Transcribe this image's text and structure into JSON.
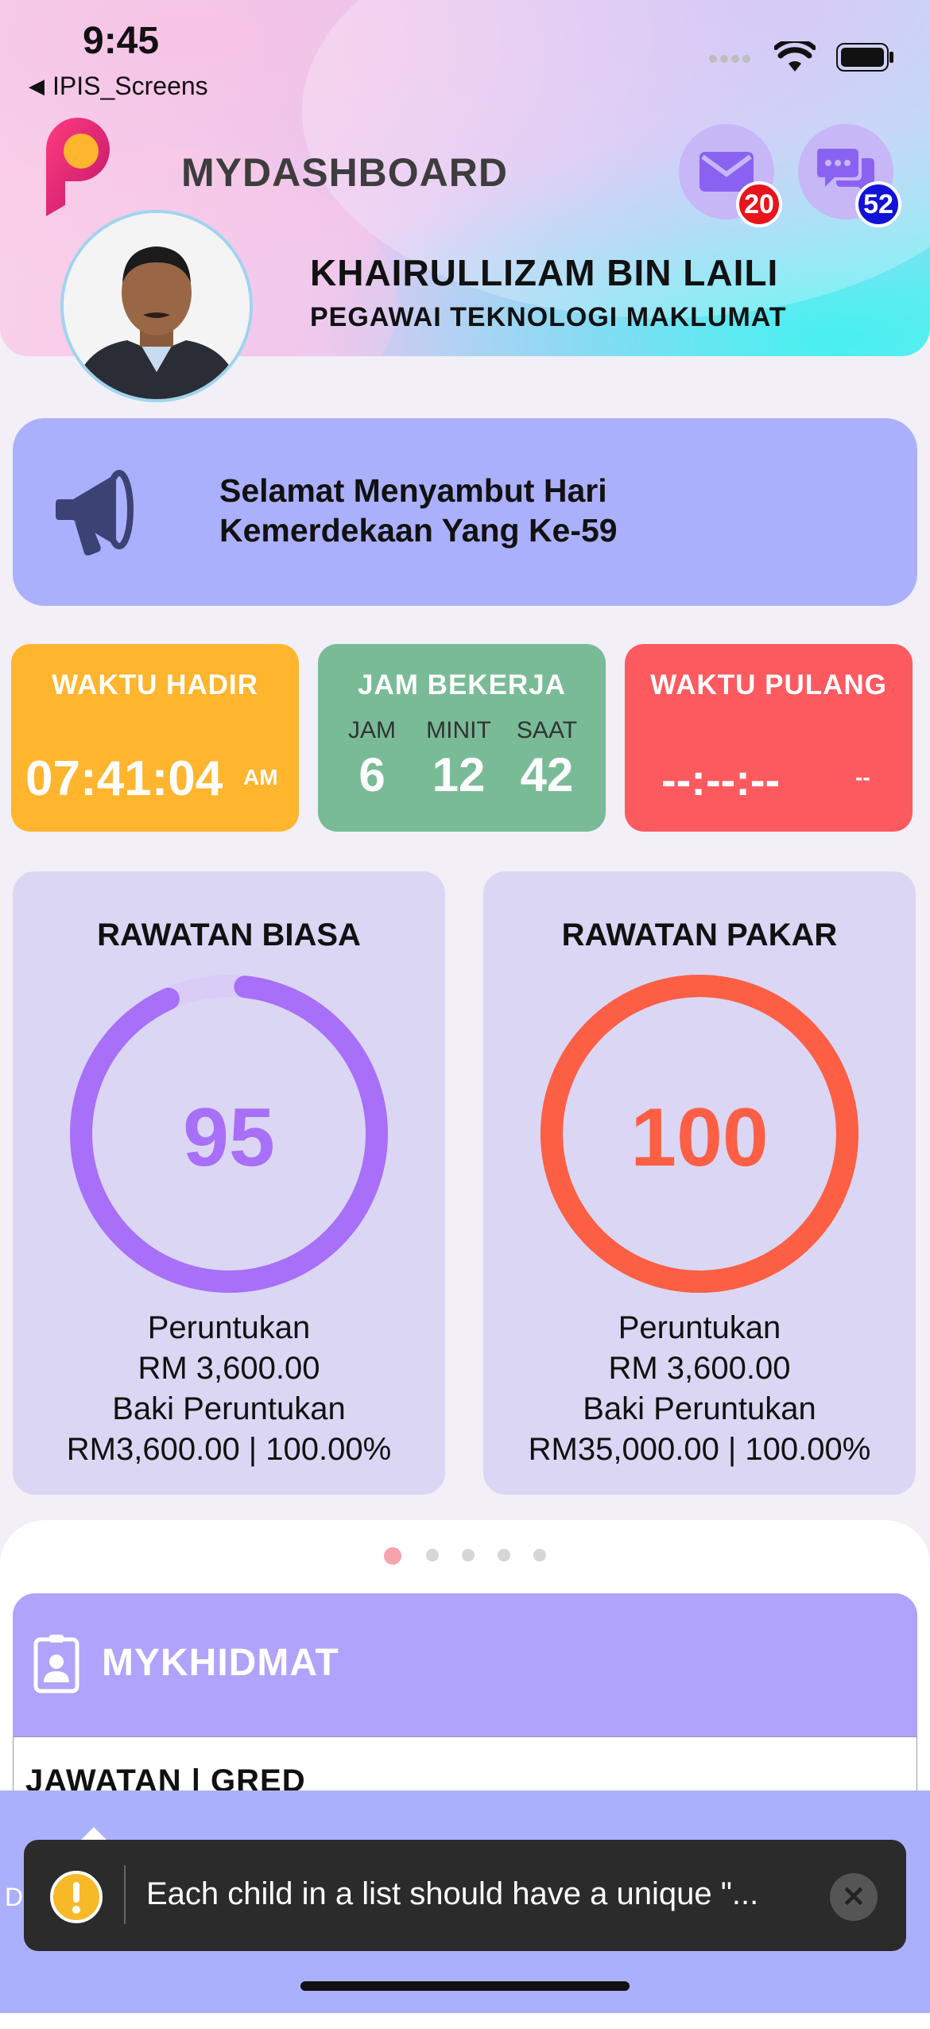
{
  "status_bar": {
    "time": "9:45",
    "back_app": "IPIS_Screens"
  },
  "header": {
    "title": "MYDASHBOARD",
    "mail_badge": "20",
    "chat_badge": "52",
    "user_name": "KHAIRULLIZAM BIN LAILI",
    "user_position": "PEGAWAI TEKNOLOGI MAKLUMAT"
  },
  "announcement": {
    "text": "Selamat Menyambut Hari Kemerdekaan Yang Ke-59"
  },
  "time_cards": {
    "arrival": {
      "label": "WAKTU HADIR",
      "time": "07:41:04",
      "period": "AM",
      "color": "#ffb52e"
    },
    "working": {
      "label": "JAM BEKERJA",
      "hours_label": "JAM",
      "minutes_label": "MINIT",
      "seconds_label": "SAAT",
      "hours": "6",
      "minutes": "12",
      "seconds": "42",
      "color": "#79bb97"
    },
    "departure": {
      "label": "WAKTU PULANG",
      "time": "--:--:--",
      "period": "--",
      "color": "#fd5a60"
    }
  },
  "treatments": [
    {
      "title": "RAWATAN BIASA",
      "value": "95",
      "progress_percent": 95,
      "allocation_label": "Peruntukan",
      "allocation": "RM 3,600.00",
      "balance_label": "Baki Peruntukan",
      "balance": "RM3,600.00 | 100.00%",
      "color": "#a86ff8",
      "track": "#d9cdf7"
    },
    {
      "title": "RAWATAN PAKAR",
      "value": "100",
      "progress_percent": 100,
      "allocation_label": "Peruntukan",
      "allocation": "RM 3,600.00",
      "balance_label": "Baki Peruntukan",
      "balance": "RM35,000.00 | 100.00%",
      "color": "#fd5f45",
      "track": "#fd5f45"
    }
  ],
  "carousel": {
    "page_count": 5,
    "active_index": 0
  },
  "mykhidmat": {
    "title": "MYKHIDMAT",
    "first_row": "JAWATAN | GRED"
  },
  "toast": {
    "message": "Each child in a list should have a unique \"...",
    "left_char": "D"
  }
}
